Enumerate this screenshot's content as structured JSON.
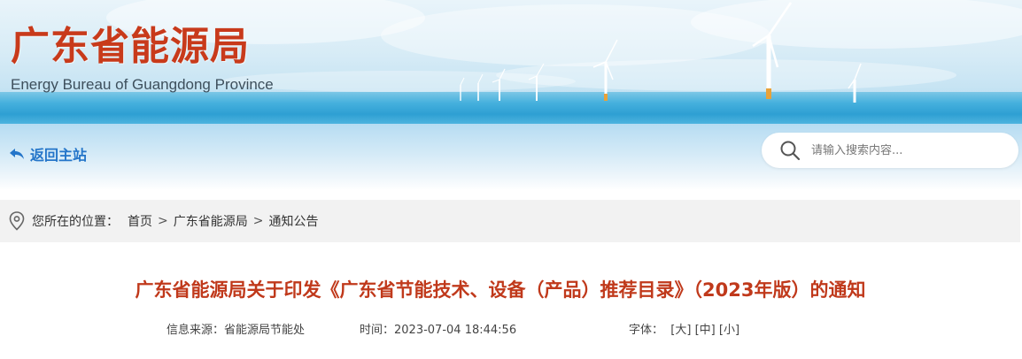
{
  "header": {
    "title": "广东省能源局",
    "subtitle": "Energy Bureau of Guangdong Province"
  },
  "nav": {
    "back_label": "返回主站",
    "search_placeholder": "请输入搜索内容..."
  },
  "breadcrumb": {
    "prefix": "您所在的位置：",
    "items": [
      "首页",
      "广东省能源局",
      "通知公告"
    ],
    "separator": ">"
  },
  "article": {
    "title": "广东省能源局关于印发《广东省节能技术、设备（产品）推荐目录》（2023年版）的通知",
    "source_label": "信息来源：",
    "source_value": "省能源局节能处",
    "time_label": "时间：",
    "time_value": "2023-07-04 18:44:56",
    "font_label": "字体：",
    "font_sizes": [
      "[大]",
      "[中]",
      "[小]"
    ]
  },
  "colors": {
    "title_red": "#c83a1b",
    "link_blue": "#2475c9",
    "sea_blue": "#2e9fd3"
  },
  "icons": {
    "back": "back-arrow-icon",
    "search": "search-icon",
    "location": "location-pin-icon",
    "turbine": "wind-turbine-icon"
  }
}
